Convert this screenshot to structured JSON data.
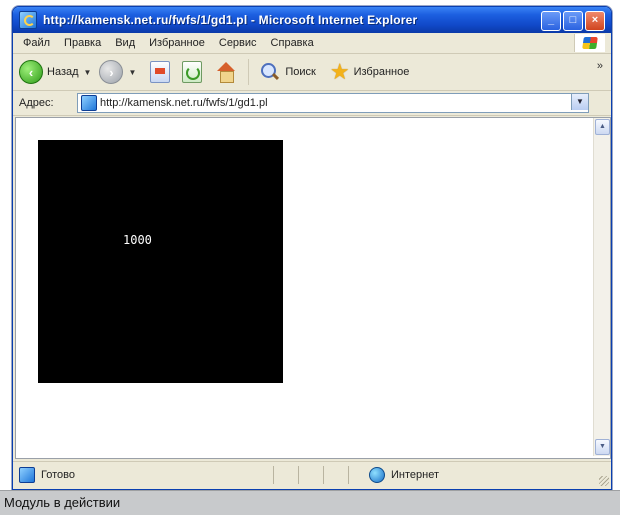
{
  "window": {
    "title": "http://kamensk.net.ru/fwfs/1/gd1.pl - Microsoft Internet Explorer",
    "buttons": {
      "minimize": "_",
      "maximize": "□",
      "close": "×"
    }
  },
  "menubar": {
    "items": [
      "Файл",
      "Правка",
      "Вид",
      "Избранное",
      "Сервис",
      "Справка"
    ]
  },
  "toolbar": {
    "back_label": "Назад",
    "search_label": "Поиск",
    "favorites_label": "Избранное"
  },
  "addressbar": {
    "label": "Адрес:",
    "url": "http://kamensk.net.ru/fwfs/1/gd1.pl"
  },
  "content": {
    "counter_text": "1000"
  },
  "statusbar": {
    "status_text": "Готово",
    "zone_text": "Интернет"
  },
  "caption": {
    "text": "Модуль в действии"
  },
  "colors": {
    "titlebar": "#1c5fe0",
    "chrome": "#ece9d8",
    "image_bg": "#000000"
  }
}
